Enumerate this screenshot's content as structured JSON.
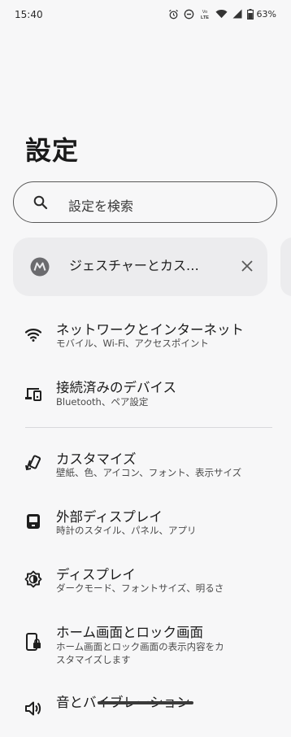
{
  "status_bar": {
    "time": "15:40",
    "battery_text": "63%",
    "icons": [
      "alarm-icon",
      "do-not-disturb-icon",
      "volte-icon",
      "wifi-icon",
      "cell-signal-icon",
      "battery-icon"
    ]
  },
  "page_title": "設定",
  "search": {
    "placeholder": "設定を検索"
  },
  "suggestion": {
    "label": "ジェスチャーとカス…"
  },
  "items": [
    {
      "title": "ネットワークとインターネット",
      "subtitle": "モバイル、Wi-Fi、アクセスポイント",
      "icon": "wifi-icon"
    },
    {
      "title": "接続済みのデバイス",
      "subtitle": "Bluetooth、ペア設定",
      "icon": "devices-icon"
    },
    {
      "title": "カスタマイズ",
      "subtitle": "壁紙、色、アイコン、フォント、表示サイズ",
      "icon": "customize-icon"
    },
    {
      "title": "外部ディスプレイ",
      "subtitle": "時計のスタイル、パネル、アプリ",
      "icon": "external-display-icon"
    },
    {
      "title": "ディスプレイ",
      "subtitle": "ダークモード、フォントサイズ、明るさ",
      "icon": "brightness-icon"
    },
    {
      "title": "ホーム画面とロック画面",
      "subtitle": "ホーム画面とロック画面の表示内容をカスタマイズします",
      "icon": "lock-screen-icon"
    },
    {
      "title": "音とバイブレーション",
      "subtitle": "",
      "icon": "volume-icon"
    }
  ]
}
